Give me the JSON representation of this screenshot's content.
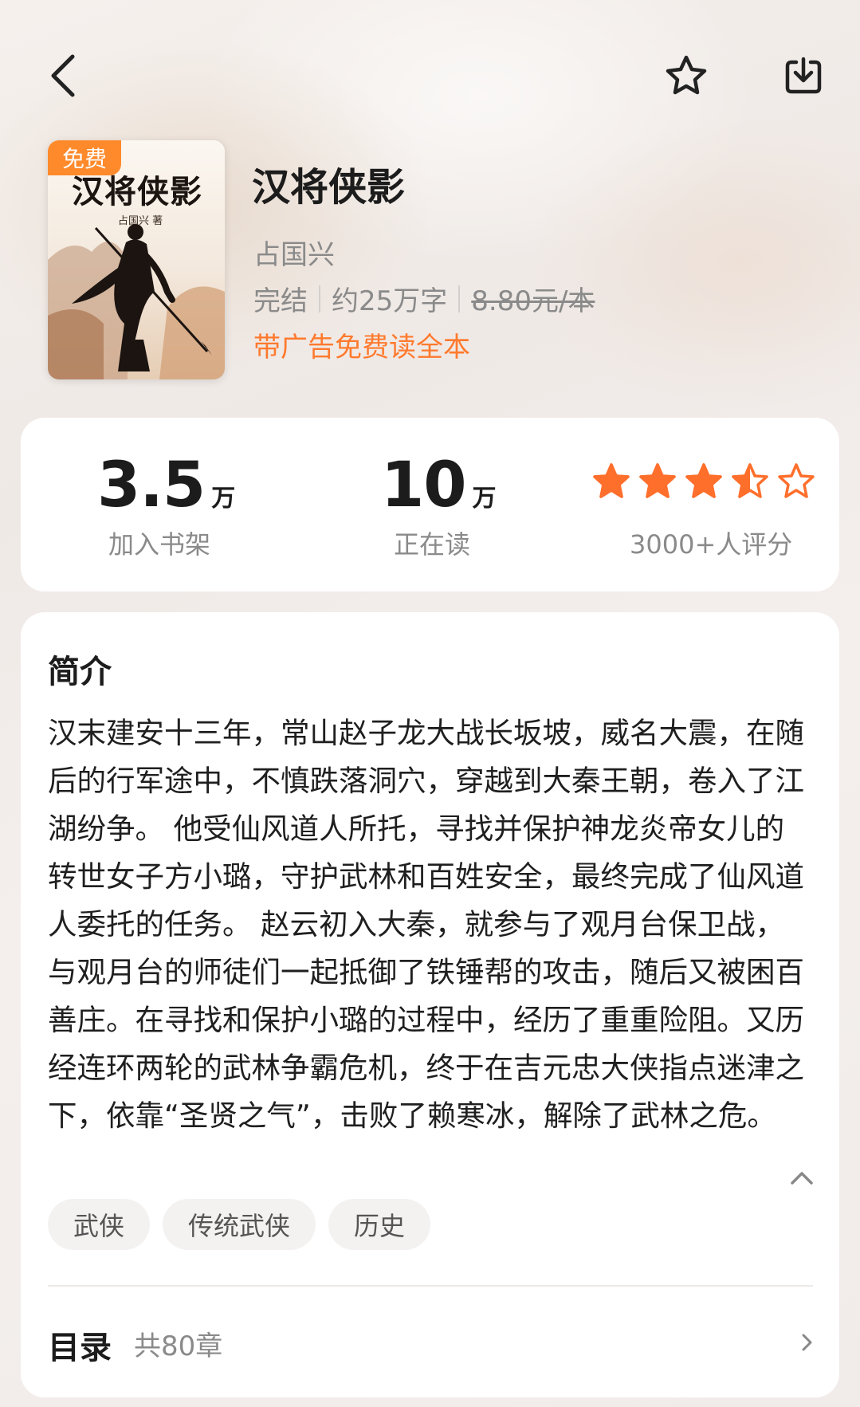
{
  "topbar": {
    "back_icon": "chevron-left-icon",
    "favorite_icon": "star-outline-icon",
    "download_icon": "download-icon"
  },
  "cover": {
    "title": "汉将侠影",
    "author_line": "占国兴 著",
    "badge": "免费"
  },
  "book": {
    "title": "汉将侠影",
    "author": "占国兴",
    "status": "完结",
    "word_count": "约25万字",
    "price": "8.80元/本",
    "promo": "带广告免费读全本"
  },
  "stats": {
    "shelf_value": "3.5",
    "shelf_unit": "万",
    "shelf_label": "加入书架",
    "reading_value": "10",
    "reading_unit": "万",
    "reading_label": "正在读",
    "rating_stars": 3.5,
    "rating_max": 5,
    "rating_label": "3000+人评分"
  },
  "intro": {
    "title": "简介",
    "text": "汉末建安十三年，常山赵子龙大战长坂坡，威名大震，在随后的行军途中，不慎跌落洞穴，穿越到大秦王朝，卷入了江湖纷争。 他受仙风道人所托，寻找并保护神龙炎帝女儿的转世女子方小璐，守护武林和百姓安全，最终完成了仙风道人委托的任务。 赵云初入大秦，就参与了观月台保卫战，与观月台的师徒们一起抵御了铁锤帮的攻击，随后又被困百善庄。在寻找和保护小璐的过程中，经历了重重险阻。又历经连环两轮的武林争霸危机，终于在吉元忠大侠指点迷津之下，依靠“圣贤之气”，击败了赖寒冰，解除了武林之危。",
    "tags": [
      "武侠",
      "传统武侠",
      "历史"
    ]
  },
  "toc": {
    "label": "目录",
    "count": "共80章"
  },
  "colors": {
    "accent": "#ff7a2e",
    "star": "#ff6f2c",
    "badge": "#ff8a2b"
  }
}
